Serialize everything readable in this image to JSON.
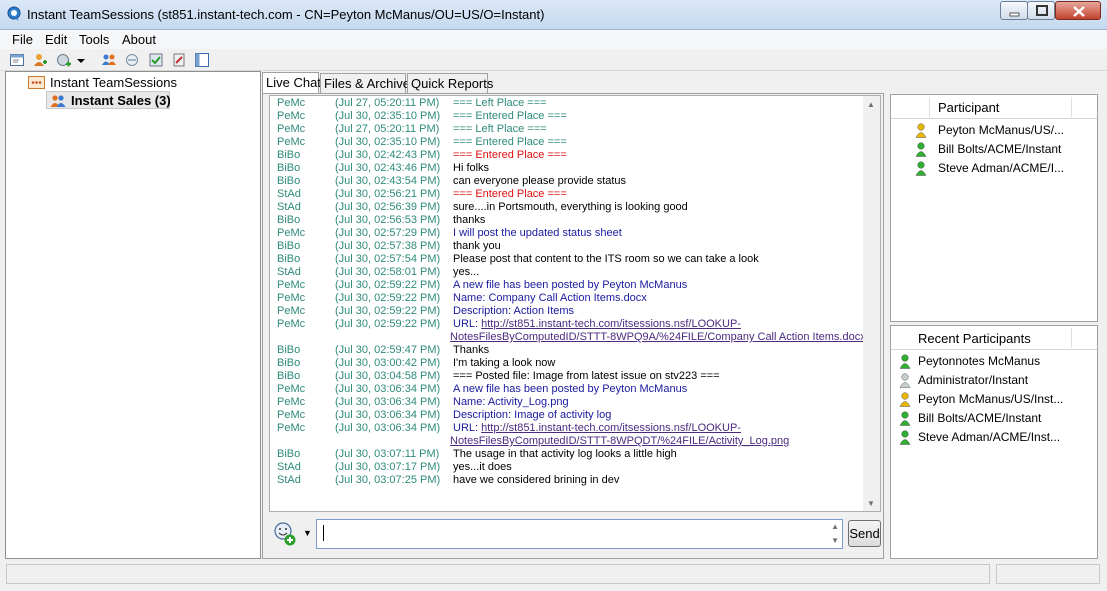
{
  "window": {
    "title": "Instant TeamSessions (st851.instant-tech.com - CN=Peyton McManus/OU=US/O=Instant)"
  },
  "menu": [
    "File",
    "Edit",
    "Tools",
    "About"
  ],
  "tree": {
    "root_label": "Instant TeamSessions",
    "child_label": "Instant Sales (3)"
  },
  "tabs": [
    "Live Chat",
    "Files & Archive",
    "Quick Reports"
  ],
  "chat": {
    "messages": [
      {
        "who": "PeMc",
        "when": "(Jul 27, 05:20:11 PM)",
        "text": "=== Left Place ===",
        "color": "green"
      },
      {
        "who": "PeMc",
        "when": "(Jul 30, 02:35:10 PM)",
        "text": "=== Entered Place ===",
        "color": "green"
      },
      {
        "who": "PeMc",
        "when": "(Jul 27, 05:20:11 PM)",
        "text": "=== Left Place ===",
        "color": "green"
      },
      {
        "who": "PeMc",
        "when": "(Jul 30, 02:35:10 PM)",
        "text": "=== Entered Place ===",
        "color": "green"
      },
      {
        "who": "BiBo",
        "when": "(Jul 30, 02:42:43 PM)",
        "text": "=== Entered Place ===",
        "color": "red"
      },
      {
        "who": "BiBo",
        "when": "(Jul 30, 02:43:46 PM)",
        "text": "Hi folks",
        "color": "black"
      },
      {
        "who": "BiBo",
        "when": "(Jul 30, 02:43:54 PM)",
        "text": "can everyone please provide status",
        "color": "black"
      },
      {
        "who": "StAd",
        "when": "(Jul 30, 02:56:21 PM)",
        "text": "=== Entered Place ===",
        "color": "red"
      },
      {
        "who": "StAd",
        "when": "(Jul 30, 02:56:39 PM)",
        "text": "sure....in Portsmouth, everything is looking good",
        "color": "black"
      },
      {
        "who": "BiBo",
        "when": "(Jul 30, 02:56:53 PM)",
        "text": "thanks",
        "color": "black"
      },
      {
        "who": "PeMc",
        "when": "(Jul 30, 02:57:29 PM)",
        "text": "I will post the updated status sheet",
        "color": "blue"
      },
      {
        "who": "BiBo",
        "when": "(Jul 30, 02:57:38 PM)",
        "text": "thank you",
        "color": "black"
      },
      {
        "who": "BiBo",
        "when": "(Jul 30, 02:57:54 PM)",
        "text": "Please post that content to the ITS room so we can take a look",
        "color": "black"
      },
      {
        "who": "StAd",
        "when": "(Jul 30, 02:58:01 PM)",
        "text": "yes...",
        "color": "black"
      },
      {
        "who": "PeMc",
        "when": "(Jul 30, 02:59:22 PM)",
        "text": "A new file has been posted by Peyton McManus",
        "color": "blue"
      },
      {
        "who": "PeMc",
        "when": "(Jul 30, 02:59:22 PM)",
        "text": "Name: Company Call Action Items.docx",
        "color": "blue"
      },
      {
        "who": "PeMc",
        "when": "(Jul 30, 02:59:22 PM)",
        "text": "Description: Action Items",
        "color": "blue"
      },
      {
        "who": "PeMc",
        "when": "(Jul 30, 02:59:22 PM)",
        "text": "URL: ",
        "link": "http://st851.instant-tech.com/itsessions.nsf/LOOKUP-",
        "cont": "NotesFilesByComputedID/STTT-8WPQ9A/%24FILE/Company Call Action Items.docx",
        "color": "blue"
      },
      {
        "who": "BiBo",
        "when": "(Jul 30, 02:59:47 PM)",
        "text": "Thanks",
        "color": "black"
      },
      {
        "who": "BiBo",
        "when": "(Jul 30, 03:00:42 PM)",
        "text": "I'm taking a look now",
        "color": "black"
      },
      {
        "who": "BiBo",
        "when": "(Jul 30, 03:04:58 PM)",
        "text": "=== Posted file: Image from latest issue on stv223 ===",
        "color": "black"
      },
      {
        "who": "PeMc",
        "when": "(Jul 30, 03:06:34 PM)",
        "text": "A new file has been posted by Peyton McManus",
        "color": "blue"
      },
      {
        "who": "PeMc",
        "when": "(Jul 30, 03:06:34 PM)",
        "text": "Name: Activity_Log.png",
        "color": "blue"
      },
      {
        "who": "PeMc",
        "when": "(Jul 30, 03:06:34 PM)",
        "text": "Description: Image of activity log",
        "color": "blue"
      },
      {
        "who": "PeMc",
        "when": "(Jul 30, 03:06:34 PM)",
        "text": "URL: ",
        "link": "http://st851.instant-tech.com/itsessions.nsf/LOOKUP-",
        "cont": "NotesFilesByComputedID/STTT-8WPQDT/%24FILE/Activity_Log.png",
        "color": "blue"
      },
      {
        "who": "BiBo",
        "when": "(Jul 30, 03:07:11 PM)",
        "text": "The usage in that activity log looks a little high",
        "color": "black"
      },
      {
        "who": "StAd",
        "when": "(Jul 30, 03:07:17 PM)",
        "text": "yes...it does",
        "color": "black"
      },
      {
        "who": "StAd",
        "when": "(Jul 30, 03:07:25 PM)",
        "text": "have we considered brining in dev",
        "color": "black"
      }
    ],
    "input_value": "",
    "send_label": "Send"
  },
  "participants": {
    "header": "Participant",
    "items": [
      {
        "name": "Peyton McManus/US/...",
        "status": "away"
      },
      {
        "name": "Bill Bolts/ACME/Instant",
        "status": "online"
      },
      {
        "name": "Steve Adman/ACME/I...",
        "status": "online"
      }
    ]
  },
  "recent": {
    "header": "Recent Participants",
    "items": [
      {
        "name": "Peytonnotes McManus",
        "status": "online"
      },
      {
        "name": "Administrator/Instant",
        "status": "offline"
      },
      {
        "name": "Peyton McManus/US/Inst...",
        "status": "away"
      },
      {
        "name": "Bill Bolts/ACME/Instant",
        "status": "online"
      },
      {
        "name": "Steve Adman/ACME/Inst...",
        "status": "online"
      }
    ]
  },
  "colors": {
    "green": "#2e8b7a",
    "red": "#e01010",
    "blue": "#1a1aa0",
    "black": "#000000",
    "status_online": "#2fae2f",
    "status_away": "#e8b800",
    "status_offline": "#c8d0d0"
  },
  "icons": {
    "app": "chat-bubble-icon",
    "toolbar": [
      "new-window-icon",
      "add-user-icon",
      "add-place-icon",
      "dropdown-arrow-icon",
      "people-icon",
      "broadcast-icon",
      "checklist-icon",
      "tools-icon",
      "panel-icon"
    ]
  }
}
